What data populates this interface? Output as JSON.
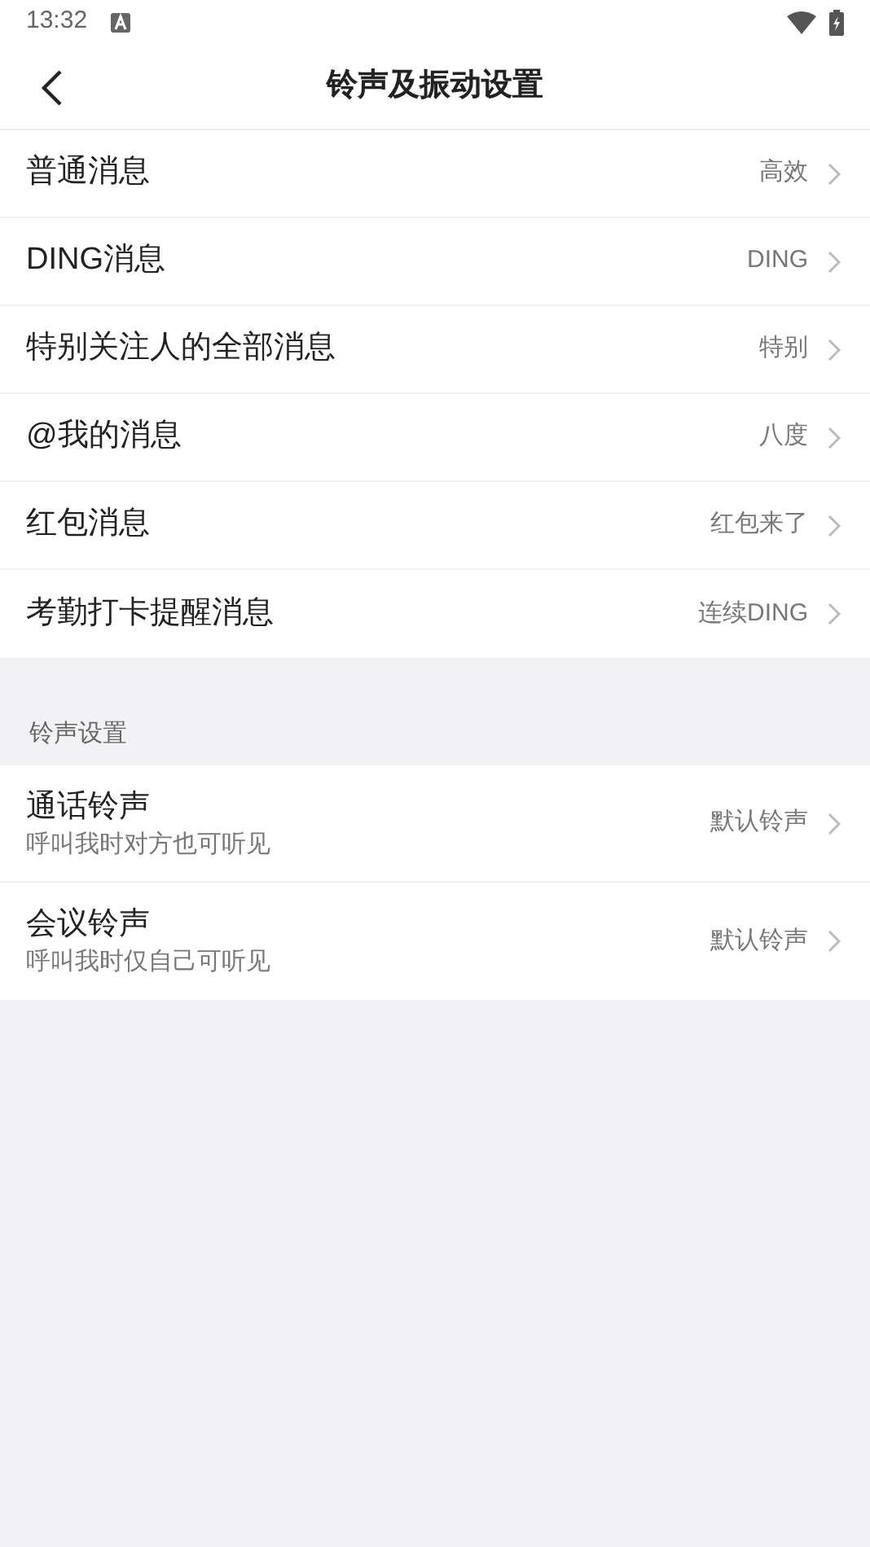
{
  "status_bar": {
    "time": "13:32"
  },
  "header": {
    "title": "铃声及振动设置"
  },
  "message_settings": [
    {
      "label": "普通消息",
      "value": "高效"
    },
    {
      "label": "DING消息",
      "value": "DING"
    },
    {
      "label": "特别关注人的全部消息",
      "value": "特别"
    },
    {
      "label": "@我的消息",
      "value": "八度"
    },
    {
      "label": "红包消息",
      "value": "红包来了"
    },
    {
      "label": "考勤打卡提醒消息",
      "value": "连续DING"
    }
  ],
  "ringtone_section": {
    "heading": "铃声设置",
    "items": [
      {
        "label": "通话铃声",
        "description": "呼叫我时对方也可听见",
        "value": "默认铃声"
      },
      {
        "label": "会议铃声",
        "description": "呼叫我时仅自己可听见",
        "value": "默认铃声"
      }
    ]
  }
}
